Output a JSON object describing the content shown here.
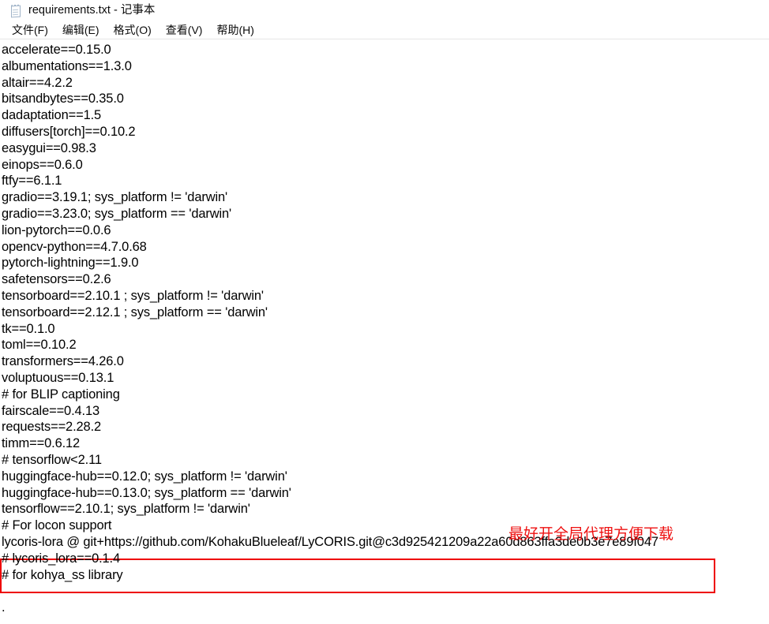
{
  "window": {
    "title": "requirements.txt - 记事本",
    "icon": "notepad-icon"
  },
  "menubar": {
    "items": [
      {
        "label": "文件(F)"
      },
      {
        "label": "编辑(E)"
      },
      {
        "label": "格式(O)"
      },
      {
        "label": "查看(V)"
      },
      {
        "label": "帮助(H)"
      }
    ]
  },
  "document": {
    "lines": [
      "accelerate==0.15.0",
      "albumentations==1.3.0",
      "altair==4.2.2",
      "bitsandbytes==0.35.0",
      "dadaptation==1.5",
      "diffusers[torch]==0.10.2",
      "easygui==0.98.3",
      "einops==0.6.0",
      "ftfy==6.1.1",
      "gradio==3.19.1; sys_platform != 'darwin'",
      "gradio==3.23.0; sys_platform == 'darwin'",
      "lion-pytorch==0.0.6",
      "opencv-python==4.7.0.68",
      "pytorch-lightning==1.9.0",
      "safetensors==0.2.6",
      "tensorboard==2.10.1 ; sys_platform != 'darwin'",
      "tensorboard==2.12.1 ; sys_platform == 'darwin'",
      "tk==0.1.0",
      "toml==0.10.2",
      "transformers==4.26.0",
      "voluptuous==0.13.1",
      "# for BLIP captioning",
      "fairscale==0.4.13",
      "requests==2.28.2",
      "timm==0.6.12",
      "# tensorflow<2.11",
      "huggingface-hub==0.12.0; sys_platform != 'darwin'",
      "huggingface-hub==0.13.0; sys_platform == 'darwin'",
      "tensorflow==2.10.1; sys_platform != 'darwin'",
      "# For locon support",
      "lycoris-lora @ git+https://github.com/KohakuBlueleaf/LyCORIS.git@c3d925421209a22a60d863ffa3de0b3e7e89f047",
      "# lycoris_lora==0.1.4",
      "# for kohya_ss library",
      "",
      "."
    ]
  },
  "annotation": {
    "note_text": "最好开全局代理方便下载",
    "note_color": "#ee1111",
    "box_color": "#ee0000"
  }
}
